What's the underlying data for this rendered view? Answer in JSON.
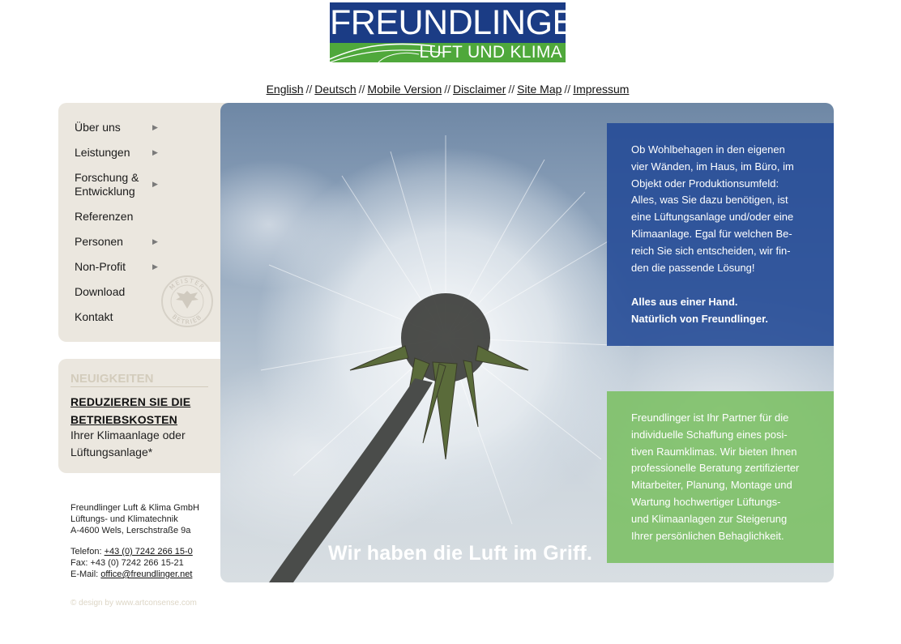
{
  "logo": {
    "name": "FREUNDLINGER",
    "tagline": "LUFT UND KLIMA",
    "colors": {
      "blue": "#1b3c85",
      "green": "#4fa83b"
    }
  },
  "toplinks": [
    {
      "label": "English"
    },
    {
      "label": "Deutsch"
    },
    {
      "label": "Mobile Version"
    },
    {
      "label": "Disclaimer"
    },
    {
      "label": "Site Map"
    },
    {
      "label": "Impressum"
    }
  ],
  "separator": "//",
  "nav": {
    "items": [
      {
        "label": "Über uns",
        "has_submenu": true
      },
      {
        "label": "Leistungen",
        "has_submenu": true
      },
      {
        "label": "Forschung &",
        "label2": "Entwicklung",
        "has_submenu": true
      },
      {
        "label": "Referenzen",
        "has_submenu": false
      },
      {
        "label": "Personen",
        "has_submenu": true
      },
      {
        "label": "Non-Profit",
        "has_submenu": true
      },
      {
        "label": "Download",
        "has_submenu": false
      },
      {
        "label": "Kontakt",
        "has_submenu": false
      }
    ],
    "arrow_glyph": "▶",
    "seal": {
      "top_text": "MEISTER",
      "bottom_text": "BETRIEB",
      "icon": "eagle-seal-icon"
    }
  },
  "news": {
    "heading": "NEUIGKEITEN",
    "title_line1": "REDUZIEREN SIE DIE",
    "title_line2": "BETRIEBSKOSTEN",
    "text_line1": "Ihrer Klimaanlage oder",
    "text_line2": "Lüftungsanlage*"
  },
  "address": {
    "company": "Freundlinger Luft & Klima GmbH",
    "line2": "Lüftungs- und Klimatechnik",
    "line3": "A-4600 Wels, Lerschstraße 9a",
    "phone_label": "Telefon:",
    "phone": "+43 (0) 7242 266 15-0",
    "fax": "Fax: +43 (0) 7242 266 15-21",
    "email_label": "E-Mail:",
    "email": "office@freundlinger.net"
  },
  "credit": "© design by www.artconsense.com",
  "hero": {
    "slogan": "Wir haben die Luft im Griff.",
    "blue_box": {
      "lines": [
        "Ob Wohlbehagen in den eigenen",
        "vier Wänden, im Haus, im Büro, im",
        "Objekt oder Produktionsumfeld:",
        "Alles, was Sie dazu benötigen, ist",
        "eine Lüftungsanlage und/oder eine",
        "Klimaanlage. Egal für welchen Be-",
        "reich Sie sich entscheiden, wir fin-",
        "den die passende Lösung!"
      ],
      "strong1": "Alles aus einer Hand.",
      "strong2": "Natürlich von Freundlinger."
    },
    "green_box": {
      "lines": [
        "Freundlinger ist Ihr Partner für die",
        "individuelle Schaffung eines posi-",
        "tiven Raumklimas. Wir bieten Ihnen",
        "professionelle Beratung zertifizierter",
        "Mitarbeiter, Planung, Montage und",
        "Wartung hochwertiger Lüftungs-",
        "und Klimaanlagen zur Steigerung",
        "Ihrer persönlichen Behaglichkeit."
      ]
    }
  }
}
